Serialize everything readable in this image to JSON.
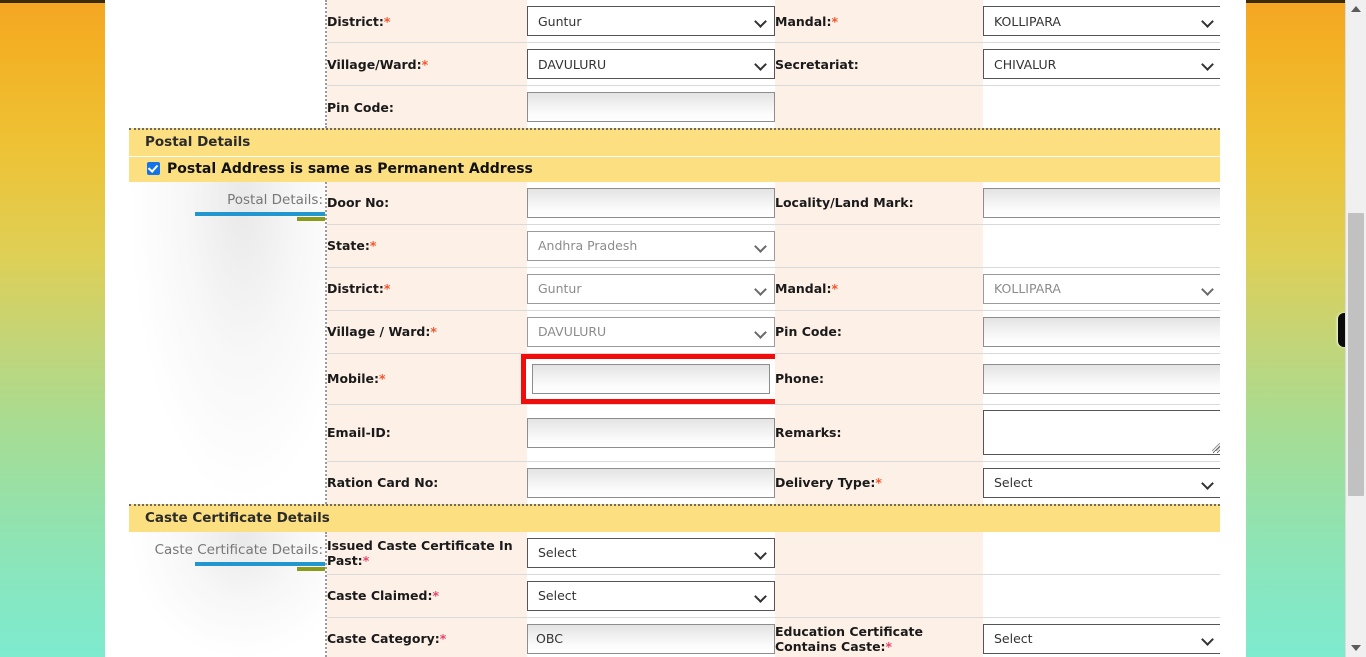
{
  "theme": {
    "band_bg": "#fcdf80",
    "label_bg": "#fdf0e7",
    "accent_blue": "#2196cf",
    "accent_olive": "#8a9a19",
    "required_star": "#f1562b",
    "highlight_red": "#f20d0d",
    "checkbox_blue": "#1473e6"
  },
  "permanent_address_rows": [
    {
      "label": "District:",
      "required": true,
      "control": {
        "kind": "select",
        "value": "Guntur",
        "disabled": false
      },
      "label2": "Mandal:",
      "required2": true,
      "control2": {
        "kind": "select",
        "value": "KOLLIPARA",
        "disabled": false
      }
    },
    {
      "label": "Village/Ward:",
      "required": true,
      "control": {
        "kind": "select",
        "value": "DAVULURU",
        "disabled": false
      },
      "label2": "Secretariat:",
      "required2": false,
      "control2": {
        "kind": "select",
        "value": "CHIVALUR",
        "disabled": false
      }
    },
    {
      "label": "Pin Code:",
      "required": false,
      "control": {
        "kind": "input",
        "value": "",
        "disabled": true
      },
      "label2": "",
      "required2": false,
      "control2": {
        "kind": "none",
        "value": "",
        "disabled": true
      }
    }
  ],
  "postal": {
    "section_title": "Postal Details",
    "same_as_permanent_label": "Postal Address is same as Permanent Address",
    "same_as_permanent_checked": true,
    "side_label": "Postal Details:",
    "rows": [
      {
        "label": "Door No:",
        "required": false,
        "control": {
          "kind": "input",
          "value": "",
          "disabled": true
        },
        "label2": "Locality/Land Mark:",
        "required2": false,
        "control2": {
          "kind": "input",
          "value": "",
          "disabled": true
        }
      },
      {
        "label": "State:",
        "required": true,
        "control": {
          "kind": "select",
          "value": "Andhra Pradesh",
          "disabled": true
        },
        "label2": "",
        "required2": false,
        "control2": {
          "kind": "none",
          "value": "",
          "disabled": true
        }
      },
      {
        "label": "District:",
        "required": true,
        "control": {
          "kind": "select",
          "value": "Guntur",
          "disabled": true
        },
        "label2": "Mandal:",
        "required2": true,
        "control2": {
          "kind": "select",
          "value": "KOLLIPARA",
          "disabled": true
        }
      },
      {
        "label": "Village / Ward:",
        "required": true,
        "control": {
          "kind": "select",
          "value": "DAVULURU",
          "disabled": true
        },
        "label2": "Pin Code:",
        "required2": false,
        "control2": {
          "kind": "input",
          "value": "",
          "disabled": true
        }
      },
      {
        "label": "Mobile:",
        "required": true,
        "control": {
          "kind": "input",
          "value": "",
          "disabled": true,
          "highlighted": true
        },
        "label2": "Phone:",
        "required2": false,
        "control2": {
          "kind": "input",
          "value": "",
          "disabled": true
        }
      },
      {
        "label": "Email-ID:",
        "required": false,
        "control": {
          "kind": "input",
          "value": "",
          "disabled": true
        },
        "label2": "Remarks:",
        "required2": false,
        "control2": {
          "kind": "textarea",
          "value": "",
          "disabled": false
        }
      },
      {
        "label": "Ration Card No:",
        "required": false,
        "control": {
          "kind": "input",
          "value": "",
          "disabled": true
        },
        "label2": "Delivery Type:",
        "required2": true,
        "control2": {
          "kind": "select",
          "value": "Select",
          "disabled": false
        }
      }
    ]
  },
  "caste": {
    "section_title": "Caste Certificate Details",
    "side_label": "Caste Certificate Details:",
    "rows": [
      {
        "label": "Issued Caste Certificate In Past:",
        "required": true,
        "control": {
          "kind": "select",
          "value": "Select",
          "disabled": false
        },
        "label2": "",
        "required2": false,
        "control2": {
          "kind": "none",
          "value": "",
          "disabled": true
        }
      },
      {
        "label": "Caste Claimed:",
        "required": true,
        "control": {
          "kind": "select",
          "value": "Select",
          "disabled": false
        },
        "label2": "",
        "required2": false,
        "control2": {
          "kind": "none",
          "value": "",
          "disabled": true
        }
      },
      {
        "label": "Caste Category:",
        "required": true,
        "control": {
          "kind": "input",
          "value": "OBC",
          "disabled": true
        },
        "label2": "Education Certificate Contains Caste:",
        "required2": true,
        "control2": {
          "kind": "select",
          "value": "Select",
          "disabled": false
        }
      }
    ]
  },
  "scrollbar": {
    "up_arrow_icon": "triangle-up-icon",
    "down_arrow_icon": "triangle-down-icon"
  },
  "edge_tab": {
    "icon": "edge-tab-handle"
  }
}
